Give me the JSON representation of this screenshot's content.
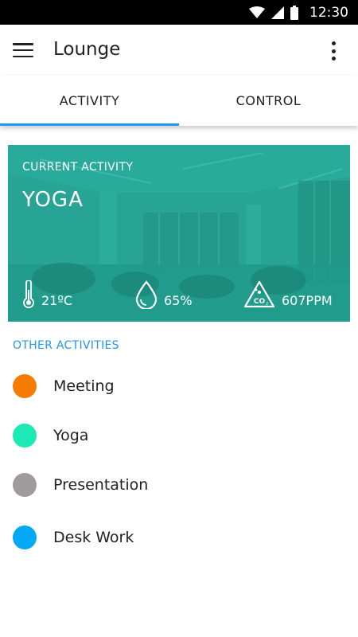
{
  "status_bar": {
    "time": "12:30",
    "icons": [
      "wifi-icon",
      "signal-icon",
      "battery-icon"
    ]
  },
  "app_bar": {
    "title": "Lounge",
    "menu_icon": "menu-icon",
    "overflow_icon": "more-vert-icon"
  },
  "tabs": [
    {
      "label": "ACTIVITY",
      "active": true
    },
    {
      "label": "CONTROL",
      "active": false
    }
  ],
  "current_activity": {
    "label": "CURRENT ACTIVITY",
    "name": "YOGA",
    "temperature": "21ºC",
    "humidity": "65%",
    "co2": "607PPM",
    "icons": [
      "thermometer-icon",
      "water-drop-icon",
      "co2-icon"
    ],
    "card_color": "#26a69a"
  },
  "other_activities": {
    "header": "OTHER ACTIVITIES",
    "items": [
      {
        "label": "Meeting",
        "color": "#f57c00"
      },
      {
        "label": "Yoga",
        "color": "#1de9b6"
      },
      {
        "label": "Presentation",
        "color": "#9e9a9e"
      },
      {
        "label": "Desk Work",
        "color": "#03a9f4"
      }
    ]
  },
  "colors": {
    "accent": "#2196f3",
    "status_bar": "#000000"
  }
}
